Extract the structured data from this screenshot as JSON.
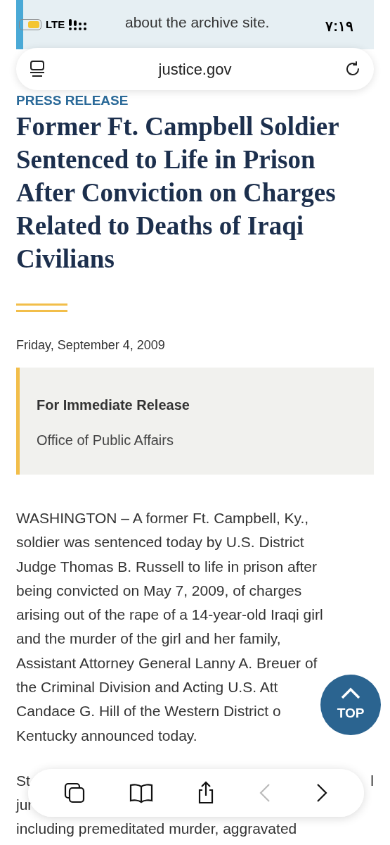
{
  "status_bar": {
    "time": "٧:١٩",
    "network": "LTE"
  },
  "banner": {
    "text": "about the archive site."
  },
  "address_bar": {
    "url": "justice.gov"
  },
  "article": {
    "eyebrow": "PRESS RELEASE",
    "headline": "Former Ft. Campbell Soldier Sentenced to Life in Prison After Conviction on Charges Related to Deaths of Iraqi Civilians",
    "date": "Friday, September 4, 2009",
    "release_box": {
      "title": "For Immediate Release",
      "office": "Office of Public Affairs"
    },
    "paragraph_lines": [
      "WASHINGTON – A former Ft. Campbell, Ky.,",
      "soldier was sentenced today by U.S. District",
      "Judge Thomas B. Russell to life in prison after",
      "being convicted on May 7, 2009, of charges",
      "arising out of the rape of a 14-year-old Iraqi girl",
      "and the murder of the girl and her family,",
      "Assistant Attorney General Lanny A. Breuer of",
      "the Criminal Division and Acting U.S. Att",
      "Candace G. Hill of the Western District o",
      "Kentucky announced today."
    ],
    "next_fragments": [
      "St",
      "l",
      "jur"
    ],
    "next_line": "including premeditated murder, aggravated"
  },
  "top_button": {
    "label": "TOP"
  }
}
